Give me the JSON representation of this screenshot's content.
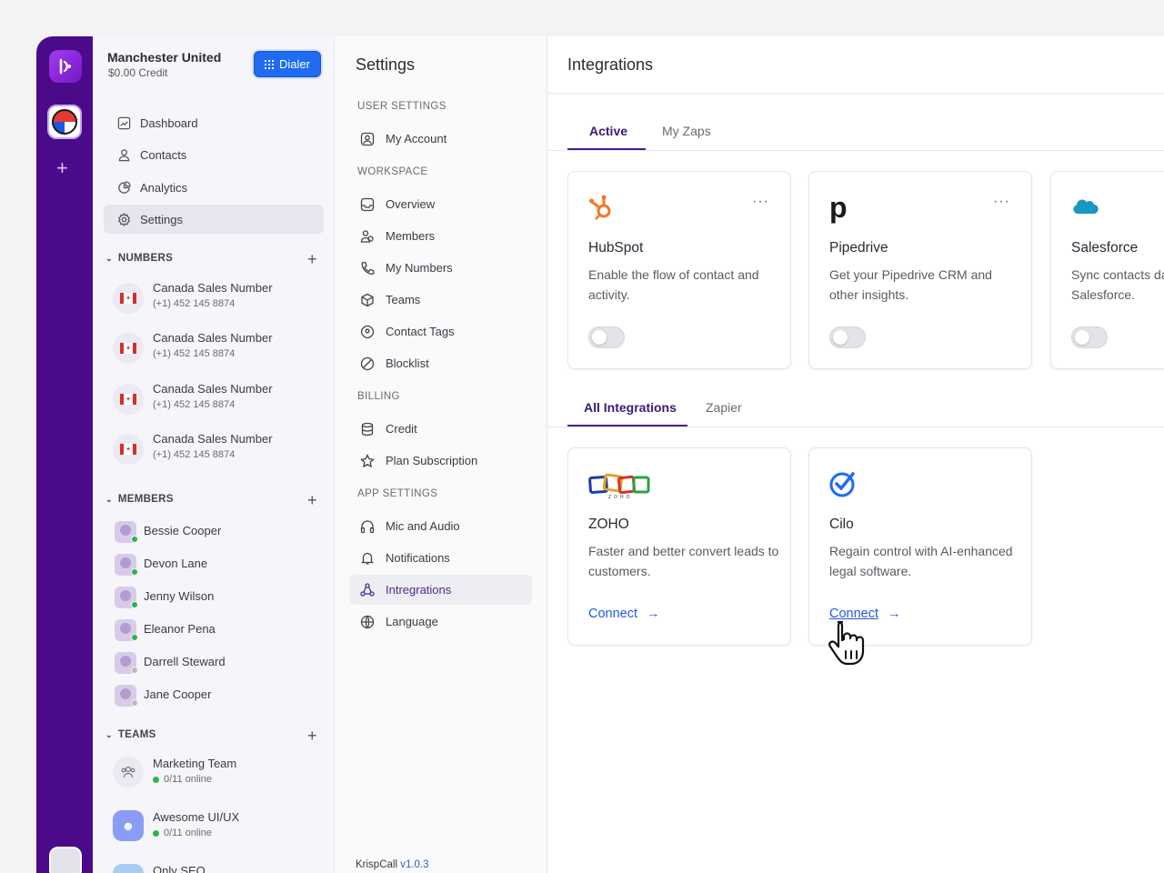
{
  "workspace": {
    "name": "Manchester United",
    "credit": "$0.00 Credit",
    "dialer_label": "Dialer"
  },
  "rail": {
    "add_label": "+"
  },
  "nav": [
    {
      "label": "Dashboard",
      "icon": "dashboard-icon"
    },
    {
      "label": "Contacts",
      "icon": "user-icon"
    },
    {
      "label": "Analytics",
      "icon": "pie-chart-icon"
    },
    {
      "label": "Settings",
      "icon": "gear-icon",
      "active": true
    }
  ],
  "numbers": {
    "title": "NUMBERS",
    "items": [
      {
        "name": "Canada Sales Number",
        "phone": "(+1) 452 145 8874"
      },
      {
        "name": "Canada Sales Number",
        "phone": "(+1) 452 145 8874"
      },
      {
        "name": "Canada Sales Number",
        "phone": "(+1) 452 145 8874"
      },
      {
        "name": "Canada Sales Number",
        "phone": "(+1) 452 145 8874"
      }
    ]
  },
  "members": {
    "title": "MEMBERS",
    "items": [
      {
        "name": "Bessie Cooper",
        "online": true
      },
      {
        "name": "Devon Lane",
        "online": true
      },
      {
        "name": "Jenny Wilson",
        "online": true
      },
      {
        "name": "Eleanor Pena",
        "online": true
      },
      {
        "name": "Darrell Steward",
        "online": false
      },
      {
        "name": "Jane Cooper",
        "online": false
      }
    ]
  },
  "teams": {
    "title": "TEAMS",
    "items": [
      {
        "name": "Marketing Team",
        "status": "0/11 online"
      },
      {
        "name": "Awesome UI/UX",
        "status": "0/11 online"
      },
      {
        "name": "Only SEO",
        "status": ""
      }
    ]
  },
  "settings": {
    "title": "Settings",
    "sections": [
      {
        "title": "USER SETTINGS",
        "items": [
          {
            "label": "My Account",
            "icon": "account-icon"
          }
        ]
      },
      {
        "title": "WORKSPACE",
        "items": [
          {
            "label": "Overview",
            "icon": "overview-icon"
          },
          {
            "label": "Members",
            "icon": "members-icon"
          },
          {
            "label": "My Numbers",
            "icon": "phone-icon"
          },
          {
            "label": "Teams",
            "icon": "cube-icon"
          },
          {
            "label": "Contact Tags",
            "icon": "tag-icon"
          },
          {
            "label": "Blocklist",
            "icon": "block-icon"
          }
        ]
      },
      {
        "title": "BILLING",
        "items": [
          {
            "label": "Credit",
            "icon": "database-icon"
          },
          {
            "label": "Plan Subscription",
            "icon": "star-icon"
          }
        ]
      },
      {
        "title": "APP SETTINGS",
        "items": [
          {
            "label": "Mic and Audio",
            "icon": "headphones-icon"
          },
          {
            "label": "Notifications",
            "icon": "bell-icon"
          },
          {
            "label": "Intregrations",
            "icon": "integrations-icon",
            "active": true
          },
          {
            "label": "Language",
            "icon": "globe-icon"
          }
        ]
      }
    ],
    "version_prefix": "KrispCall ",
    "version": "v1.0.3"
  },
  "integrations": {
    "title": "Integrations",
    "top_tabs": [
      {
        "label": "Active",
        "active": true
      },
      {
        "label": "My Zaps",
        "active": false
      }
    ],
    "active_cards": [
      {
        "name": "HubSpot",
        "desc": "Enable the flow of contact and activity.",
        "logo": "hubspot-logo",
        "enabled": false
      },
      {
        "name": "Pipedrive",
        "desc": "Get your Pipedrive CRM and other insights.",
        "logo": "pipedrive-logo",
        "enabled": false
      },
      {
        "name": "Salesforce",
        "desc": "Sync contacts data of KrispCall and Salesforce.",
        "logo": "salesforce-logo",
        "enabled": false
      }
    ],
    "more_label": "···",
    "bottom_tabs": [
      {
        "label": "All Integrations",
        "active": true
      },
      {
        "label": "Zapier",
        "active": false
      }
    ],
    "all_cards": [
      {
        "name": "ZOHO",
        "desc": "Faster and better convert leads to customers.",
        "logo": "zoho-logo",
        "action": "Connect"
      },
      {
        "name": "Cilo",
        "desc": "Regain control with AI-enhanced legal software.",
        "logo": "cilo-logo",
        "action": "Connect"
      }
    ]
  },
  "colors": {
    "rail": "#4a0a8a",
    "accent": "#4a1a9a",
    "dialer": "#1f6bf2",
    "link": "#2458d8",
    "online": "#2fb344"
  }
}
